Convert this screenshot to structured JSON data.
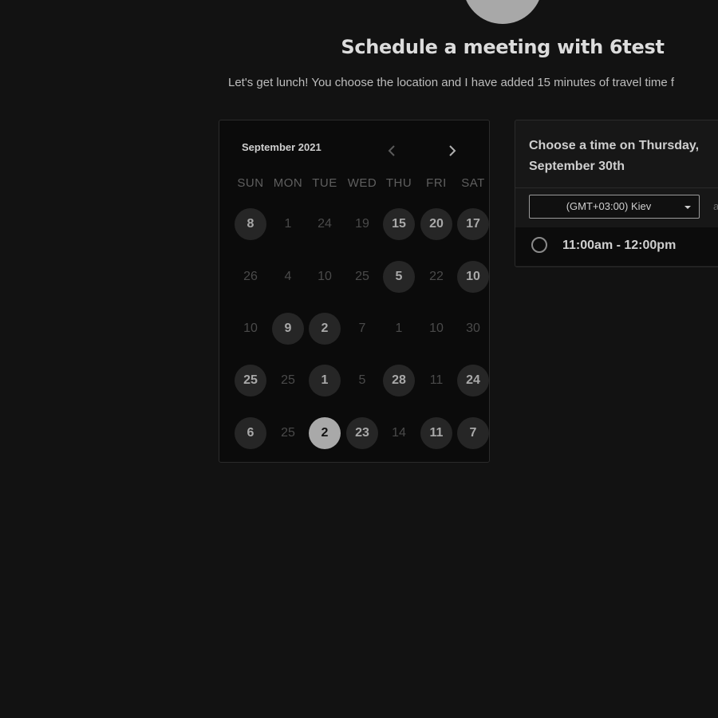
{
  "header": {
    "title": "Schedule a meeting with 6test",
    "subtitle": "Let's get lunch! You choose the location and I have added 15 minutes of travel time f"
  },
  "calendar": {
    "month_label": "September 2021",
    "prev_icon": "chevron-left-icon",
    "next_icon": "chevron-right-icon",
    "weekdays": [
      "SUN",
      "MON",
      "TUE",
      "WED",
      "THU",
      "FRI",
      "SAT"
    ],
    "weeks": [
      [
        {
          "label": "8",
          "state": "available"
        },
        {
          "label": "1",
          "state": "disabled"
        },
        {
          "label": "24",
          "state": "disabled"
        },
        {
          "label": "19",
          "state": "disabled"
        },
        {
          "label": "15",
          "state": "available"
        },
        {
          "label": "20",
          "state": "available"
        },
        {
          "label": "17",
          "state": "available"
        }
      ],
      [
        {
          "label": "26",
          "state": "disabled"
        },
        {
          "label": "4",
          "state": "disabled"
        },
        {
          "label": "10",
          "state": "disabled"
        },
        {
          "label": "25",
          "state": "disabled"
        },
        {
          "label": "5",
          "state": "available"
        },
        {
          "label": "22",
          "state": "disabled"
        },
        {
          "label": "10",
          "state": "available"
        }
      ],
      [
        {
          "label": "10",
          "state": "disabled"
        },
        {
          "label": "9",
          "state": "available"
        },
        {
          "label": "2",
          "state": "available"
        },
        {
          "label": "7",
          "state": "disabled"
        },
        {
          "label": "1",
          "state": "disabled"
        },
        {
          "label": "10",
          "state": "disabled"
        },
        {
          "label": "30",
          "state": "disabled"
        }
      ],
      [
        {
          "label": "25",
          "state": "available"
        },
        {
          "label": "25",
          "state": "disabled"
        },
        {
          "label": "1",
          "state": "available"
        },
        {
          "label": "5",
          "state": "disabled"
        },
        {
          "label": "28",
          "state": "available"
        },
        {
          "label": "11",
          "state": "disabled"
        },
        {
          "label": "24",
          "state": "available"
        }
      ],
      [
        {
          "label": "6",
          "state": "available"
        },
        {
          "label": "25",
          "state": "disabled"
        },
        {
          "label": "2",
          "state": "selected"
        },
        {
          "label": "23",
          "state": "available"
        },
        {
          "label": "14",
          "state": "disabled"
        },
        {
          "label": "11",
          "state": "available"
        },
        {
          "label": "7",
          "state": "available"
        }
      ]
    ]
  },
  "time_panel": {
    "title": "Choose a time on Thursday, September 30th",
    "timezone": "(GMT+03:00) Kiev",
    "timezone_extra": "a",
    "slots": [
      "11:00am - 12:00pm"
    ]
  },
  "colors": {
    "background": "#121212",
    "calendar_bg": "#0b0b0b",
    "available_day": "#262626",
    "selected_day": "#a9a9a9"
  }
}
